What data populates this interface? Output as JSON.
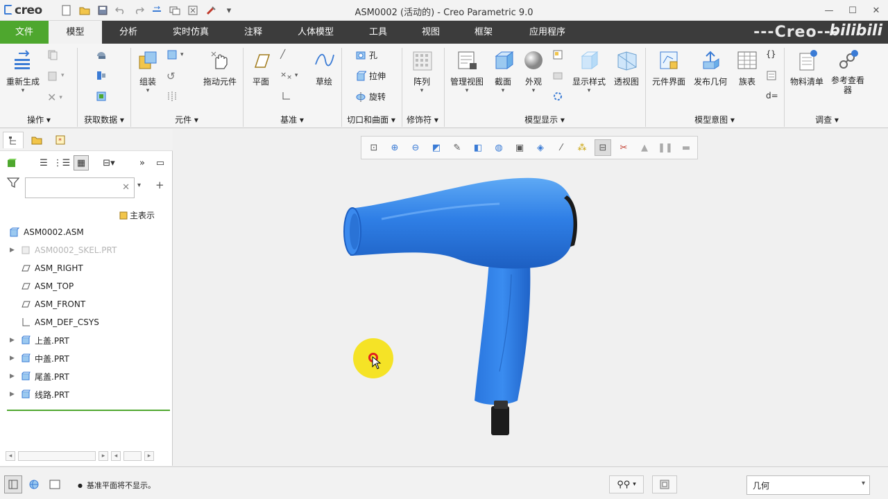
{
  "app": {
    "logo_text": "creo",
    "window_title": "ASM0002 (活动的) - Creo Parametric 9.0",
    "watermark": "---Creo---",
    "bili_logo": "bilibili"
  },
  "quick_access": [
    "new-icon",
    "open-icon",
    "save-icon",
    "undo-icon",
    "redo-icon",
    "regenerate-icon",
    "windows-icon",
    "close-window-icon",
    "tool-icon",
    "more-icon"
  ],
  "tabs": [
    {
      "label": "文件"
    },
    {
      "label": "模型"
    },
    {
      "label": "分析"
    },
    {
      "label": "实时仿真"
    },
    {
      "label": "注释"
    },
    {
      "label": "人体模型"
    },
    {
      "label": "工具"
    },
    {
      "label": "视图"
    },
    {
      "label": "框架"
    },
    {
      "label": "应用程序"
    }
  ],
  "ribbon": {
    "operations": {
      "label": "操作",
      "regen": "重新生成"
    },
    "get_data": {
      "label": "获取数据"
    },
    "components": {
      "label": "元件",
      "assemble": "组装",
      "drag": "拖动元件"
    },
    "datum": {
      "label": "基准",
      "plane": "平面",
      "sketch": "草绘"
    },
    "cut_surface": {
      "label": "切口和曲面",
      "hole": "孔",
      "extrude": "拉伸",
      "revolve": "旋转"
    },
    "modifiers": {
      "label": "修饰符",
      "pattern": "阵列"
    },
    "model_display": {
      "label": "模型显示",
      "manage_views": "管理视图",
      "section": "截面",
      "appearance": "外观",
      "display_style": "显示样式",
      "perspective": "透视图"
    },
    "model_intent": {
      "label": "模型意图",
      "component_interface": "元件界面",
      "publish_geometry": "发布几何",
      "family_table": "族表"
    },
    "investigate": {
      "label": "调查",
      "bom": "物料清单",
      "reference_viewer": "参考查看器"
    }
  },
  "left_panel": {
    "search_placeholder": "",
    "main_display": "主表示",
    "tree": [
      {
        "label": "ASM0002.ASM",
        "type": "asm",
        "expandable": false,
        "dim": false
      },
      {
        "label": "ASM0002_SKEL.PRT",
        "type": "skel",
        "expandable": true,
        "dim": true
      },
      {
        "label": "ASM_RIGHT",
        "type": "plane",
        "expandable": false,
        "dim": false
      },
      {
        "label": "ASM_TOP",
        "type": "plane",
        "expandable": false,
        "dim": false
      },
      {
        "label": "ASM_FRONT",
        "type": "plane",
        "expandable": false,
        "dim": false
      },
      {
        "label": "ASM_DEF_CSYS",
        "type": "csys",
        "expandable": false,
        "dim": false
      },
      {
        "label": "上盖.PRT",
        "type": "part",
        "expandable": true,
        "dim": false
      },
      {
        "label": "中盖.PRT",
        "type": "part",
        "expandable": true,
        "dim": false
      },
      {
        "label": "尾盖.PRT",
        "type": "part",
        "expandable": true,
        "dim": false
      },
      {
        "label": "线路.PRT",
        "type": "part",
        "expandable": true,
        "dim": false
      }
    ]
  },
  "view_toolbar": [
    "refit-icon",
    "zoom-in-icon",
    "zoom-out-icon",
    "repaint-icon",
    "spin-center-icon",
    "display-style-icon",
    "saved-views-icon",
    "view-manager-icon",
    "appearance-icon",
    "datum-display-icon",
    "annotation-display-icon",
    "section-icon",
    "explode-icon",
    "simulation-icon",
    "pause-icon",
    "stop-icon"
  ],
  "status": {
    "message": "基准平面将不显示。",
    "filter_value": "几何"
  },
  "colors": {
    "accent_green": "#4ea72e",
    "tab_dark": "#3c3c3c",
    "model_blue": "#2f7fe6",
    "cursor_highlight": "#f4e11a"
  }
}
